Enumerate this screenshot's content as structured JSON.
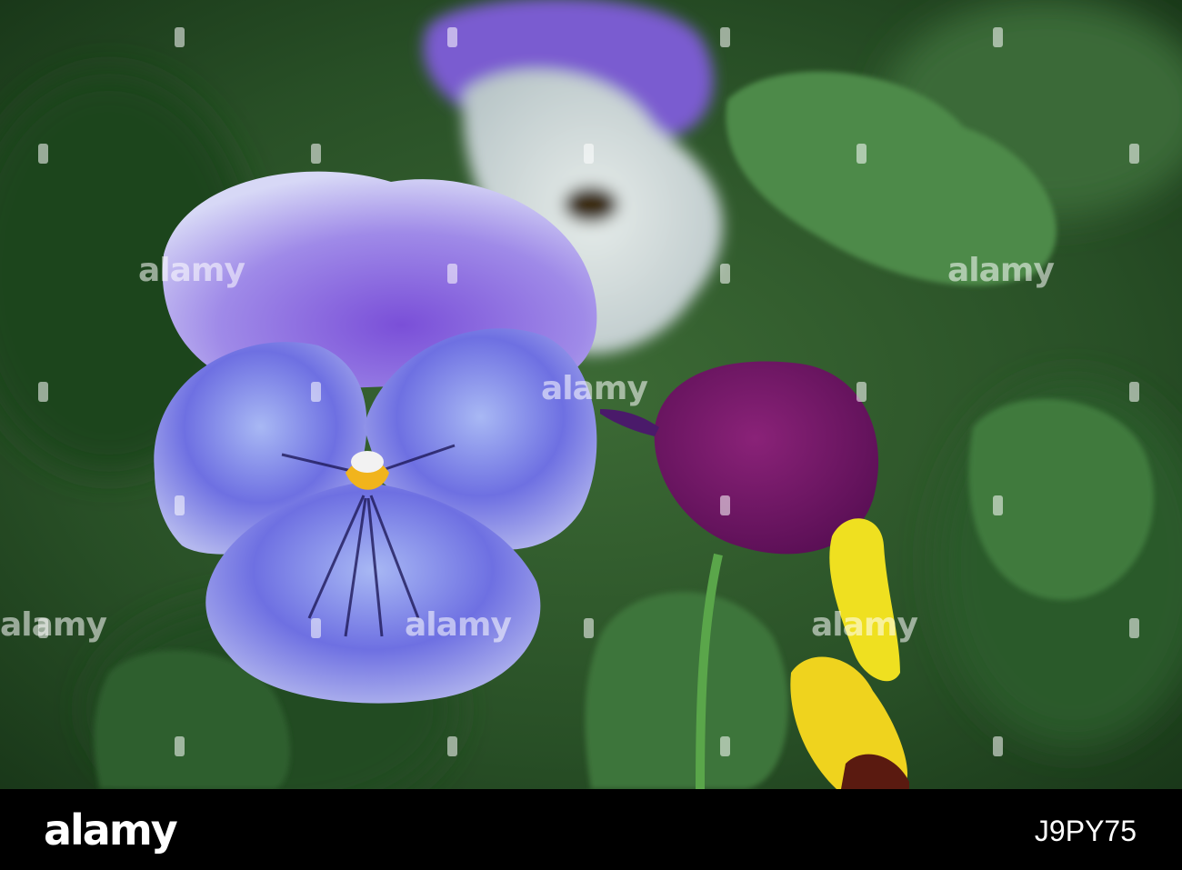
{
  "watermark": {
    "text": "alamy"
  },
  "footer": {
    "brand": "alamy",
    "image_id": "J9PY75"
  },
  "colors": {
    "background_green": "#2f5a2c",
    "pansy_blue": "#6b6fe0",
    "pansy_purple": "#7a1a6a",
    "pansy_yellow": "#f0d020",
    "footer_bg": "#000000"
  }
}
